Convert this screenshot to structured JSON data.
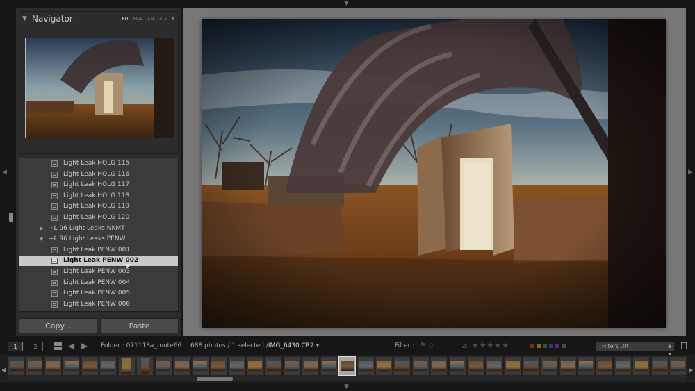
{
  "navigator": {
    "title": "Navigator",
    "zoom_options": [
      "FIT",
      "FILL",
      "1:1",
      "3:1"
    ],
    "zoom_active": "FIT"
  },
  "presets": {
    "items": [
      {
        "type": "preset",
        "label": "Light Leak HOLG 115",
        "selected": false
      },
      {
        "type": "preset",
        "label": "Light Leak HOLG 116",
        "selected": false
      },
      {
        "type": "preset",
        "label": "Light Leak HOLG 117",
        "selected": false
      },
      {
        "type": "preset",
        "label": "Light Leak HOLG 118",
        "selected": false
      },
      {
        "type": "preset",
        "label": "Light Leak HOLG 119",
        "selected": false
      },
      {
        "type": "preset",
        "label": "Light Leak HOLG 120",
        "selected": false
      },
      {
        "type": "folder",
        "label": "+L 96 Light Leaks NKMT",
        "expanded": false
      },
      {
        "type": "folder",
        "label": "+L 96 Light Leaks PENW",
        "expanded": true
      },
      {
        "type": "preset",
        "label": "Light Leak PENW 001",
        "selected": false
      },
      {
        "type": "preset",
        "label": "Light Leak PENW 002",
        "selected": true
      },
      {
        "type": "preset",
        "label": "Light Leak PENW 003",
        "selected": false
      },
      {
        "type": "preset",
        "label": "Light Leak PENW 004",
        "selected": false
      },
      {
        "type": "preset",
        "label": "Light Leak PENW 005",
        "selected": false
      },
      {
        "type": "preset",
        "label": "Light Leak PENW 006",
        "selected": false
      }
    ]
  },
  "buttons": {
    "copy": "Copy...",
    "paste": "Paste"
  },
  "toolbar": {
    "screen1": "1",
    "screen2": "2",
    "folder": "Folder : 071118a_route66",
    "photo_count": "688 photos / 1 selected /",
    "filename": "IMG_6430.CR2",
    "filter_label": "Filter :",
    "rating_op": "≥",
    "filters_value": "Filters Off"
  },
  "icons": {
    "grid": "grid-view-icon",
    "back": "back-arrow-icon",
    "forward": "forward-arrow-icon",
    "flags": "flag-filter-icon",
    "stars": "star-rating-icon",
    "lock": "filter-lock-icon"
  },
  "colors": {
    "panel_bg": "#2c2c2c",
    "list_bg": "#3b3b3b",
    "selected_row": "#c9c9c9",
    "viewer_bg": "#777777",
    "label_red": "#7a2a2a",
    "label_yellow": "#7a6a20",
    "label_green": "#2a5a2a",
    "label_blue": "#2a3a7a",
    "label_purple": "#5a2a6a"
  },
  "filmstrip": {
    "selected_index": 18,
    "cells": [
      "l",
      "l",
      "l",
      "l",
      "l",
      "l",
      "p",
      "p",
      "l",
      "l",
      "l",
      "l",
      "l",
      "l",
      "l",
      "l",
      "l",
      "l",
      "l",
      "l",
      "l",
      "l",
      "l",
      "l",
      "l",
      "l",
      "l",
      "l",
      "l",
      "l",
      "l",
      "l",
      "l",
      "l",
      "l",
      "l",
      "l"
    ]
  }
}
